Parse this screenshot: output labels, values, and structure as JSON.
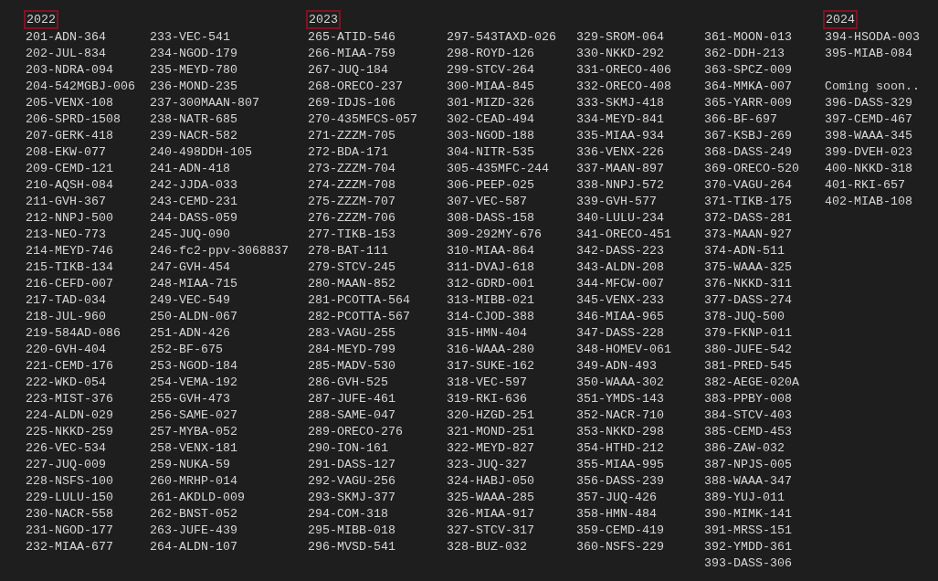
{
  "years": [
    {
      "title": "2022",
      "columns": [
        [
          "201-ADN-364",
          "202-JUL-834",
          "203-NDRA-094",
          "204-542MGBJ-006",
          "205-VENX-108",
          "206-SPRD-1508",
          "207-GERK-418",
          "208-EKW-077",
          "209-CEMD-121",
          "210-AQSH-084",
          "211-GVH-367",
          "212-NNPJ-500",
          "213-NEO-773",
          "214-MEYD-746",
          "215-TIKB-134",
          "216-CEFD-007",
          "217-TAD-034",
          "218-JUL-960",
          "219-584AD-086",
          "220-GVH-404",
          "221-CEMD-176",
          "222-WKD-054",
          "223-MIST-376",
          "224-ALDN-029",
          "225-NKKD-259",
          "226-VEC-534",
          "227-JUQ-009",
          "228-NSFS-100",
          "229-LULU-150",
          "230-NACR-558",
          "231-NGOD-177",
          "232-MIAA-677"
        ],
        [
          "233-VEC-541",
          "234-NGOD-179",
          "235-MEYD-780",
          "236-MOND-235",
          "237-300MAAN-807",
          "238-NATR-685",
          "239-NACR-582",
          "240-498DDH-105",
          "241-ADN-418",
          "242-JJDA-033",
          "243-CEMD-231",
          "244-DASS-059",
          "245-JUQ-090",
          "246-fc2-ppv-3068837",
          "247-GVH-454",
          "248-MIAA-715",
          "249-VEC-549",
          "250-ALDN-067",
          "251-ADN-426",
          "252-BF-675",
          "253-NGOD-184",
          "254-VEMA-192",
          "255-GVH-473",
          "256-SAME-027",
          "257-MYBA-052",
          "258-VENX-181",
          "259-NUKA-59",
          "260-MRHP-014",
          "261-AKDLD-009",
          "262-BNST-052",
          "263-JUFE-439",
          "264-ALDN-107"
        ]
      ]
    },
    {
      "title": "2023",
      "columns": [
        [
          "265-ATID-546",
          "266-MIAA-759",
          "267-JUQ-184",
          "268-ORECO-237",
          "269-IDJS-106",
          "270-435MFCS-057",
          "271-ZZZM-705",
          "272-BDA-171",
          "273-ZZZM-704",
          "274-ZZZM-708",
          "275-ZZZM-707",
          "276-ZZZM-706",
          "277-TIKB-153",
          "278-BAT-111",
          "279-STCV-245",
          "280-MAAN-852",
          "281-PCOTTA-564",
          "282-PCOTTA-567",
          "283-VAGU-255",
          "284-MEYD-799",
          "285-MADV-530",
          "286-GVH-525",
          "287-JUFE-461",
          "288-SAME-047",
          "289-ORECO-276",
          "290-ION-161",
          "291-DASS-127",
          "292-VAGU-256",
          "293-SKMJ-377",
          "294-COM-318",
          "295-MIBB-018",
          "296-MVSD-541"
        ],
        [
          "297-543TAXD-026",
          "298-ROYD-126",
          "299-STCV-264",
          "300-MIAA-845",
          "301-MIZD-326",
          "302-CEAD-494",
          "303-NGOD-188",
          "304-NITR-535",
          "305-435MFC-244",
          "306-PEEP-025",
          "307-VEC-587",
          "308-DASS-158",
          "309-292MY-676",
          "310-MIAA-864",
          "311-DVAJ-618",
          "312-GDRD-001",
          "313-MIBB-021",
          "314-CJOD-388",
          "315-HMN-404",
          "316-WAAA-280",
          "317-SUKE-162",
          "318-VEC-597",
          "319-RKI-636",
          "320-HZGD-251",
          "321-MOND-251",
          "322-MEYD-827",
          "323-JUQ-327",
          "324-HABJ-050",
          "325-WAAA-285",
          "326-MIAA-917",
          "327-STCV-317",
          "328-BUZ-032"
        ],
        [
          "329-SROM-064",
          "330-NKKD-292",
          "331-ORECO-406",
          "332-ORECO-408",
          "333-SKMJ-418",
          "334-MEYD-841",
          "335-MIAA-934",
          "336-VENX-226",
          "337-MAAN-897",
          "338-NNPJ-572",
          "339-GVH-577",
          "340-LULU-234",
          "341-ORECO-451",
          "342-DASS-223",
          "343-ALDN-208",
          "344-MFCW-007",
          "345-VENX-233",
          "346-MIAA-965",
          "347-DASS-228",
          "348-HOMEV-061",
          "349-ADN-493",
          "350-WAAA-302",
          "351-YMDS-143",
          "352-NACR-710",
          "353-NKKD-298",
          "354-HTHD-212",
          "355-MIAA-995",
          "356-DASS-239",
          "357-JUQ-426",
          "358-HMN-484",
          "359-CEMD-419",
          "360-NSFS-229"
        ],
        [
          "361-MOON-013",
          "362-DDH-213",
          "363-SPCZ-009",
          "364-MMKA-007",
          "365-YARR-009",
          "366-BF-697",
          "367-KSBJ-269",
          "368-DASS-249",
          "369-ORECO-520",
          "370-VAGU-264",
          "371-TIKB-175",
          "372-DASS-281",
          "373-MAAN-927",
          "374-ADN-511",
          "375-WAAA-325",
          "376-NKKD-311",
          "377-DASS-274",
          "378-JUQ-500",
          "379-FKNP-011",
          "380-JUFE-542",
          "381-PRED-545",
          "382-AEGE-020A",
          "383-PPBY-008",
          "384-STCV-403",
          "385-CEMD-453",
          "386-ZAW-032",
          "387-NPJS-005",
          "388-WAAA-347",
          "389-YUJ-011",
          "390-MIMK-141",
          "391-MRSS-151",
          "392-YMDD-361",
          "393-DASS-306"
        ]
      ]
    },
    {
      "title": "2024",
      "columns": [
        [
          "394-HSODA-003",
          "395-MIAB-084"
        ]
      ],
      "note": "Coming soon..",
      "upcoming": [
        "396-DASS-329",
        "397-CEMD-467",
        "398-WAAA-345",
        "399-DVEH-023",
        "400-NKKD-318",
        "401-RKI-657",
        "402-MIAB-108"
      ]
    }
  ]
}
